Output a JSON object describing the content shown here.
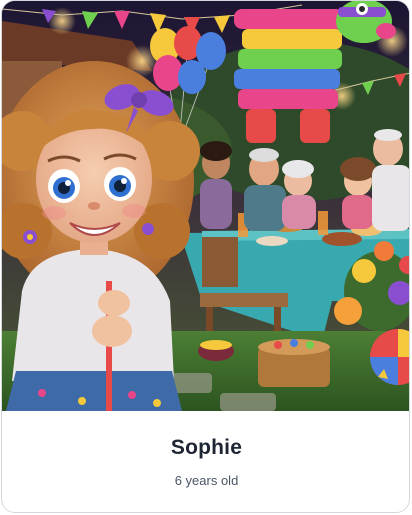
{
  "profile_card": {
    "name": "Sophie",
    "age_text": "6 years old"
  },
  "scene": {
    "subject": "Cartoon girl with curly hair and purple bow at a birthday party with pinata, balloons and family at a table",
    "colors": {
      "sky_top": "#1c1533",
      "foliage": "#2f4a2a",
      "pinata_pink": "#e8458a",
      "pinata_green": "#6fcf4e",
      "pinata_yellow": "#f5c93b",
      "pinata_blue": "#4a7fe0",
      "tablecloth": "#39a9b0",
      "hair": "#c9843c",
      "sweater": "#e9e6ea",
      "skirt": "#3f6aa8",
      "bow": "#8a4fd0",
      "grass": "#3d6b2d"
    }
  }
}
